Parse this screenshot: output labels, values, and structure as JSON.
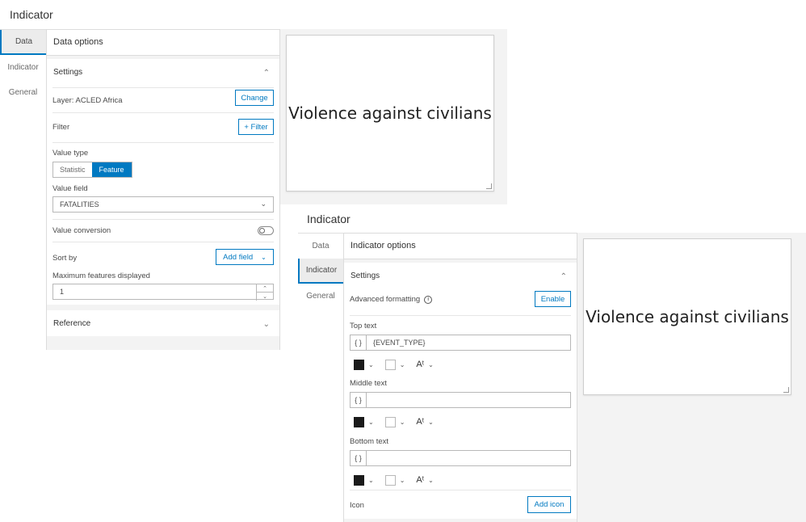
{
  "panel1": {
    "title": "Indicator",
    "tabs": [
      "Data",
      "Indicator",
      "General"
    ],
    "active_tab": "Data",
    "header": "Data options",
    "settings_label": "Settings",
    "layer_label": "Layer: ACLED Africa",
    "change_button": "Change",
    "filter_label": "Filter",
    "filter_button": "+ Filter",
    "value_type_label": "Value type",
    "value_type_options": [
      "Statistic",
      "Feature"
    ],
    "value_type_selected": "Feature",
    "value_field_label": "Value field",
    "value_field_value": "FATALITIES",
    "value_conversion_label": "Value conversion",
    "sort_by_label": "Sort by",
    "add_field_button": "Add field",
    "max_features_label": "Maximum features displayed",
    "max_features_value": "1",
    "reference_label": "Reference",
    "preview_text": "Violence against civilians"
  },
  "panel2": {
    "title": "Indicator",
    "tabs": [
      "Data",
      "Indicator",
      "General"
    ],
    "active_tab": "Indicator",
    "header": "Indicator options",
    "settings_label": "Settings",
    "advanced_formatting_label": "Advanced formatting",
    "enable_button": "Enable",
    "top_text_label": "Top text",
    "top_text_value": "{EVENT_TYPE}",
    "middle_text_label": "Middle text",
    "middle_text_value": "",
    "bottom_text_label": "Bottom text",
    "bottom_text_value": "",
    "brace_glyph": "{ }",
    "icon_label": "Icon",
    "add_icon_button": "Add icon",
    "preview_text": "Violence against civilians"
  },
  "colors": {
    "accent": "#0079c1",
    "text_color_swatch": "#1a1a1a",
    "background_swatch": "#ffffff"
  }
}
